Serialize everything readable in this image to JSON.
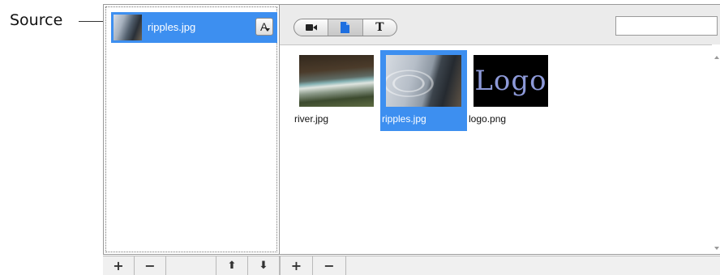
{
  "callout": {
    "label": "Source"
  },
  "sources": {
    "items": [
      {
        "name": "ripples.jpg",
        "selected": true,
        "font_button": "A"
      }
    ],
    "toolbar": {
      "add": "+",
      "remove": "−",
      "move_up": "⬆",
      "move_down": "⬇"
    }
  },
  "media": {
    "toolbar": {
      "segments": [
        {
          "icon": "video-camera-icon",
          "selected": false
        },
        {
          "icon": "document-icon",
          "selected": true
        },
        {
          "label": "T",
          "icon": "text-icon",
          "selected": false
        }
      ],
      "search_value": ""
    },
    "items": [
      {
        "name": "river.jpg",
        "selected": false,
        "thumb": "river"
      },
      {
        "name": "ripples.jpg",
        "selected": true,
        "thumb": "ripples"
      },
      {
        "name": "logo.png",
        "selected": false,
        "thumb": "logo",
        "thumb_text": "Logo"
      }
    ],
    "bottom_toolbar": {
      "add": "+",
      "remove": "−"
    }
  },
  "colors": {
    "selection": "#3d8ff0",
    "toolbar_bg": "#ebebeb",
    "border": "#9a9a9a"
  }
}
